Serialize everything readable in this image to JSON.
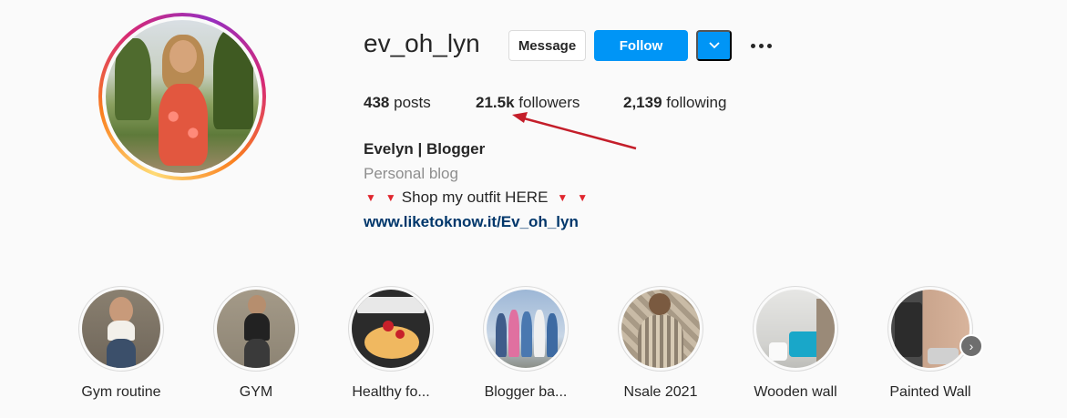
{
  "profile": {
    "username": "ev_oh_lyn",
    "message_label": "Message",
    "follow_label": "Follow",
    "dropdown_icon": "chevron-down-icon",
    "more_icon": "more-options-icon"
  },
  "stats": {
    "posts_count": "438",
    "posts_label": "posts",
    "followers_count": "21.5k",
    "followers_label": "followers",
    "following_count": "2,139",
    "following_label": "following"
  },
  "bio": {
    "name": "Evelyn | Blogger",
    "category": "Personal blog",
    "line": "Shop my outfit HERE",
    "link": "www.liketoknow.it/Ev_oh_lyn"
  },
  "annotation": {
    "arrow_color": "#c41e2a"
  },
  "highlights": [
    {
      "label": "Gym routine"
    },
    {
      "label": "GYM"
    },
    {
      "label": "Healthy fo..."
    },
    {
      "label": "Blogger ba..."
    },
    {
      "label": "Nsale 2021"
    },
    {
      "label": "Wooden wall"
    },
    {
      "label": "Painted Wall"
    }
  ],
  "colors": {
    "follow_blue": "#0095f6",
    "link_blue": "#00376b",
    "muted_gray": "#8e8e8e",
    "triangle_red": "#e0262e"
  }
}
